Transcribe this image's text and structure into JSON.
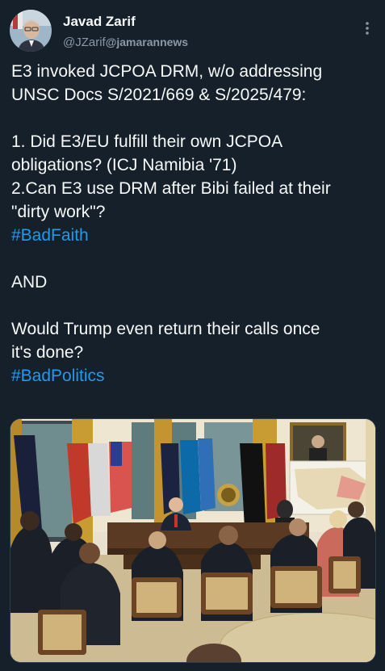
{
  "author": {
    "display_name": "Javad Zarif",
    "handle": "@JZarif",
    "via": "@jamarannews",
    "avatar_icon": "avatar-photo-icon"
  },
  "menu": {
    "more_icon": "more-vertical-icon"
  },
  "tweet": {
    "lines": [
      "E3 invoked JCPOA DRM, w/o addressing",
      "UNSC Docs S/2021/669 & S/2025/479:",
      "1. Did E3/EU fulfill their own JCPOA",
      "obligations? (ICJ Namibia '71)",
      "2.Can E3 use DRM after Bibi failed at their",
      "\"dirty work\"?",
      "AND",
      "Would Trump even return their calls once",
      "it's done?"
    ],
    "hashtag_1": "#BadFaith",
    "hashtag_2": "#BadPolitics"
  },
  "media": {
    "type": "photo",
    "scene": "oval-office-meeting",
    "colors": {
      "background": "#15202b",
      "text": "#f7f9f9",
      "muted": "#8b98a5",
      "link": "#1d9bf0"
    }
  }
}
